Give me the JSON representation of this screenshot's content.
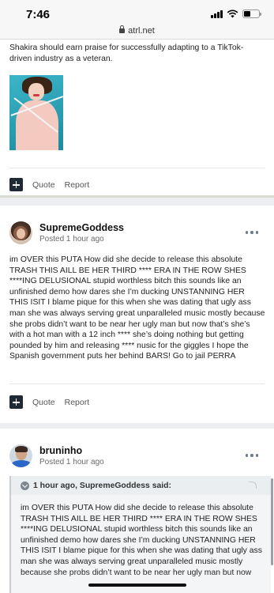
{
  "status_bar": {
    "time": "7:46"
  },
  "browser": {
    "url": "atrl.net"
  },
  "post1": {
    "text": "Shakira should earn praise for successfully adapting to a TikTok-driven industry as a veteran.",
    "actions": {
      "quote": "Quote",
      "report": "Report"
    }
  },
  "post2": {
    "author": "SupremeGoddess",
    "posted": "Posted 1 hour ago",
    "text": "im OVER this PUTA How did she decide to release this absolute TRASH THIS AILL BE HER THIRD **** ERA IN THE ROW SHES ****ING DELUSIONAL stupid worthless bitch this sounds like an unfinished demo how dares she I’m ducking UNSTANNING HER THIS ISIT I blame pique for this when she was dating that ugly ass man she was always serving great unparalleled music mostly because she probs didn’t want to be near her ugly man but now that’s she’s with a hot man with a 12 inch **** she’s doing nothing but getting pounded by him and releasing **** nusic for the giggles I hope the Spanish government puts her behind BARS! Go to jail PERRA",
    "actions": {
      "quote": "Quote",
      "report": "Report"
    }
  },
  "post3": {
    "author": "bruninho",
    "posted": "Posted 1 hour ago",
    "quote_header": "1 hour ago, SupremeGoddess said:",
    "quote_text": "im OVER this PUTA How did she decide to release this absolute TRASH THIS AILL BE HER THIRD **** ERA IN THE ROW SHES ****ING DELUSIONAL stupid worthless bitch this sounds like an unfinished demo how dares she I’m ducking UNSTANNING HER THIS ISIT I blame pique for this when she was dating that ugly ass man she was always serving great unparalleled music mostly because she probs didn’t want to be near her ugly man but now"
  }
}
